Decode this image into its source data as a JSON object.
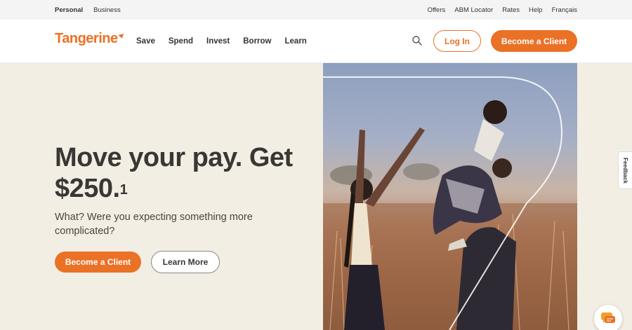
{
  "utility": {
    "left": [
      "Personal",
      "Business"
    ],
    "right": [
      "Offers",
      "ABM Locator",
      "Rates",
      "Help",
      "Français"
    ]
  },
  "nav": {
    "logo": "Tangerine",
    "links": [
      "Save",
      "Spend",
      "Invest",
      "Borrow",
      "Learn"
    ],
    "login": "Log In",
    "become_client": "Become a Client"
  },
  "hero": {
    "headline": "Move your pay. Get $250.",
    "footnote": "1",
    "subhead": "What? Were you expecting something more complicated?",
    "primary_button": "Become a Client",
    "secondary_button": "Learn More"
  },
  "feedback": "Feedback",
  "colors": {
    "brand_orange": "#ea7125",
    "hero_bg": "#f2eee4",
    "text_dark": "#3a3634"
  },
  "icons": [
    "search-icon",
    "chat-icon",
    "logo-mark-icon"
  ]
}
